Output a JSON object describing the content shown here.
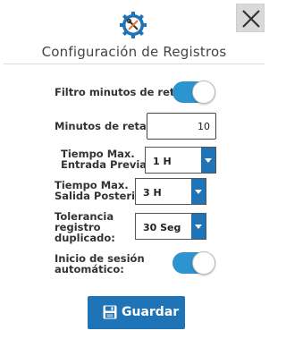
{
  "dialog": {
    "title": "Configuración de Registros",
    "header_icon": "gear-with-tools-icon",
    "close_icon": "close-icon"
  },
  "fields": {
    "filtro_minutos": {
      "label": "Filtro minutos de retardo",
      "on": true
    },
    "minutos_retardo": {
      "label": "Minutos de retardo:",
      "value": "10"
    },
    "tiempo_entrada": {
      "label_line1": "Tiempo Max.",
      "label_line2": "Entrada Previa :",
      "value": "1 H"
    },
    "tiempo_salida": {
      "label_line1": "Tiempo Max.",
      "label_line2": "Salida Posterior:",
      "value": "3 H"
    },
    "tolerancia": {
      "label_line1": "Tolerancia",
      "label_line2": "registro",
      "label_line3": "duplicado:",
      "value": "30 Seg"
    },
    "inicio_sesion": {
      "label_line1": "Inicio de sesión",
      "label_line2": "automático:",
      "on": true
    }
  },
  "save_button": {
    "label": "Guardar",
    "icon": "floppy-disk-icon"
  },
  "colors": {
    "accent": "#2c94cf",
    "button": "#1f73b7",
    "header_icon": "#1f73b7",
    "header_icon_accent": "#e87722"
  }
}
